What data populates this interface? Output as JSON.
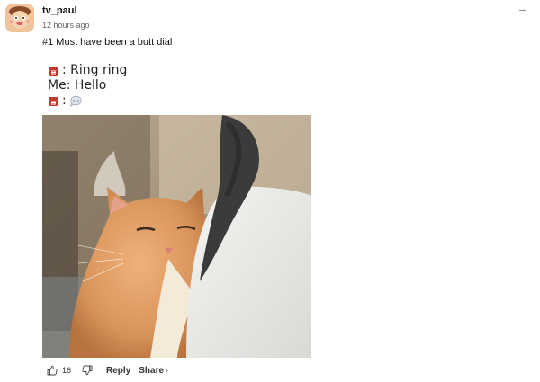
{
  "post": {
    "username": "tv_paul",
    "timestamp": "12 hours ago",
    "title": "#1 Must have been a butt dial"
  },
  "caption": {
    "line1": ": Ring ring",
    "line2": "Me: Hello",
    "line3": ":"
  },
  "icons": {
    "phone": "telephone-icon",
    "bubble": "speech-bubble-icon",
    "like": "thumbs-up-icon",
    "dislike": "thumbs-down-icon",
    "menu": "more-options-icon",
    "share_chevron": "chevron-right-icon"
  },
  "actions": {
    "like_count": "16",
    "reply_label": "Reply",
    "share_label": "Share",
    "share_chevron": "›"
  },
  "colors": {
    "phone_red": "#c0392b",
    "cat_orange": "#d8935a"
  }
}
